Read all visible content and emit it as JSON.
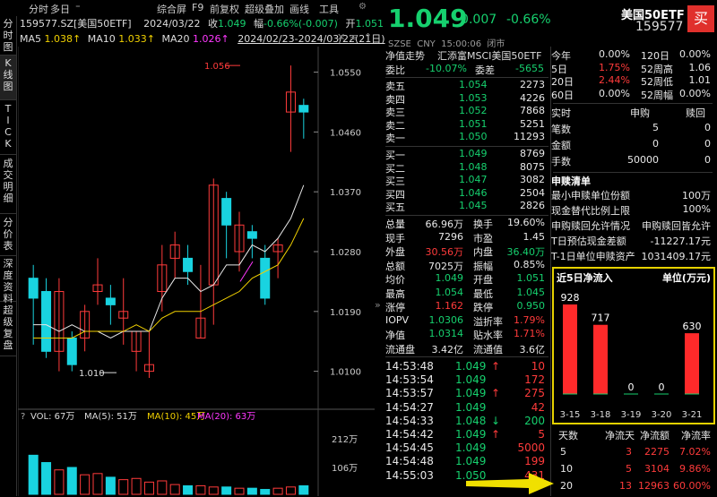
{
  "topbar": {
    "tab_intraday": "分时",
    "tab_multiday": "多日",
    "settings_glyph": "⁼",
    "comprehensive": "综合屏",
    "f9": "F9",
    "prev_adj": "前复权",
    "overlay": "超级叠加",
    "draw": "画线",
    "tools": "工具"
  },
  "info": {
    "code_name": "159577.SZ[美国50ETF]",
    "date": "2024/03/22",
    "close_label": "收",
    "close": "1.049",
    "amp_label": "幅",
    "amp": "-0.66%(-0.007)",
    "open_label": "开",
    "open": "1.051"
  },
  "ma": {
    "ma5": "MA5",
    "ma5_val": "1.038↑",
    "ma10": "MA10",
    "ma10_val": "1.033↑",
    "ma20": "MA20",
    "ma20_val": "1.026↑",
    "range": "2024/02/23-2024/03/22(21日)"
  },
  "sidetabs": [
    "分时图",
    "K线图",
    "TICK",
    "成交明细",
    "分价表",
    "深度资料",
    "超级复盘"
  ],
  "kline": {
    "high_label": "1.056",
    "low_label": "1.010",
    "price_ticks": [
      "1.0550",
      "1.0460",
      "1.0370",
      "1.0280",
      "1.0190",
      "1.0100"
    ],
    "candles": [
      [
        1.024,
        1.021,
        1.026,
        1.014
      ],
      [
        1.022,
        1.013,
        1.024,
        1.012
      ],
      [
        1.013,
        1.022,
        1.024,
        1.01
      ],
      [
        1.015,
        1.011,
        1.016,
        1.01
      ],
      [
        1.015,
        1.019,
        1.02,
        1.013
      ],
      [
        1.022,
        1.023,
        1.027,
        1.02
      ],
      [
        1.021,
        1.02,
        1.023,
        1.017
      ],
      [
        1.018,
        1.019,
        1.024,
        1.014
      ],
      [
        1.013,
        1.016,
        1.016,
        1.01
      ],
      [
        1.01,
        1.011,
        1.016,
        1.009
      ],
      [
        1.022,
        1.026,
        1.029,
        1.019
      ],
      [
        1.027,
        1.029,
        1.031,
        1.024
      ],
      [
        1.027,
        1.025,
        1.029,
        1.023
      ],
      [
        1.015,
        1.018,
        1.026,
        1.015
      ],
      [
        1.023,
        1.038,
        1.039,
        1.017
      ],
      [
        1.036,
        1.032,
        1.037,
        1.027
      ],
      [
        1.028,
        1.032,
        1.034,
        1.025
      ],
      [
        1.031,
        1.03,
        1.032,
        1.027
      ],
      [
        1.027,
        1.021,
        1.029,
        1.02
      ],
      [
        1.028,
        1.029,
        1.03,
        1.024
      ],
      [
        1.049,
        1.052,
        1.056,
        1.043
      ],
      [
        1.05,
        1.049,
        1.051,
        1.045
      ]
    ],
    "ma5": [
      1.017,
      1.017,
      1.016,
      1.017,
      1.016,
      1.016,
      1.015,
      1.016,
      1.016,
      1.016,
      1.021,
      1.024,
      1.024,
      1.022,
      1.023,
      1.026,
      1.026,
      1.029,
      1.028,
      1.03,
      1.033,
      1.038
    ],
    "ma10": [
      1.015,
      1.015,
      1.015,
      1.015,
      1.016,
      1.016,
      1.016,
      1.016,
      1.017,
      1.016,
      1.018,
      1.019,
      1.019,
      1.019,
      1.02,
      1.021,
      1.022,
      1.024,
      1.025,
      1.026,
      1.029,
      1.033
    ],
    "ma20_start": 20,
    "ma20": [
      1.026
    ]
  },
  "volume": {
    "label": "VOL: 67万",
    "ma5": "MA(5): 51万",
    "ma10": "MA(10): 45万",
    "ma20": "MA(20): 63万",
    "ticks": [
      "212万",
      "106万"
    ],
    "bars": [
      0.32,
      0.26,
      0.2,
      0.22,
      0.16,
      0.17,
      0.14,
      0.12,
      0.13,
      0.1,
      0.11,
      0.08,
      0.07,
      0.07,
      0.06,
      0.06,
      0.05,
      0.05,
      0.04,
      0.05,
      0.06,
      0.07
    ]
  },
  "quote": {
    "price": "1.049",
    "chg": "-0.007",
    "pct": "-0.66%",
    "name": "美国50ETF",
    "code": "159577",
    "sell": "买",
    "meta": "SZSE  CNY  15:00:06  闭市",
    "trend_label": "净值走势",
    "fund_name": "汇添富MSCI美国50ETF",
    "weibi_label": "委比",
    "weibi": "-10.07%",
    "weicha_label": "委差",
    "weicha": "-5655"
  },
  "asks": [
    [
      "卖五",
      "1.054",
      "2273"
    ],
    [
      "卖四",
      "1.053",
      "4226"
    ],
    [
      "卖三",
      "1.052",
      "7868"
    ],
    [
      "卖二",
      "1.051",
      "5251"
    ],
    [
      "卖一",
      "1.050",
      "11293"
    ]
  ],
  "bids": [
    [
      "买一",
      "1.049",
      "8769"
    ],
    [
      "买二",
      "1.048",
      "8075"
    ],
    [
      "买三",
      "1.047",
      "3082"
    ],
    [
      "买四",
      "1.046",
      "2504"
    ],
    [
      "买五",
      "1.045",
      "2826"
    ]
  ],
  "stats": [
    [
      "总量",
      "66.96万",
      "换手",
      "19.60%"
    ],
    [
      "现手",
      "7296",
      "市盈",
      "1.45"
    ],
    [
      "外盘",
      "30.56万",
      "内盘",
      "36.40万"
    ],
    [
      "总额",
      "7025万",
      "振幅",
      "0.85%"
    ],
    [
      "均价",
      "1.049",
      "开盘",
      "1.051"
    ],
    [
      "最高",
      "1.054",
      "最低",
      "1.045"
    ],
    [
      "涨停",
      "1.162",
      "跌停",
      "0.950"
    ],
    [
      "IOPV",
      "1.0306",
      "溢折率",
      "1.79%"
    ],
    [
      "净值",
      "1.0314",
      "贴水率",
      "1.71%"
    ],
    [
      "流通盘",
      "3.42亿",
      "流通值",
      "3.6亿"
    ]
  ],
  "trades": [
    [
      "14:53:48",
      "1.049",
      "↑",
      "10"
    ],
    [
      "14:53:54",
      "1.049",
      "",
      "172"
    ],
    [
      "14:53:57",
      "1.049",
      "↑",
      "275"
    ],
    [
      "14:54:27",
      "1.049",
      "",
      "42"
    ],
    [
      "14:54:33",
      "1.048",
      "↓",
      "200"
    ],
    [
      "14:54:42",
      "1.049",
      "↑",
      "5"
    ],
    [
      "14:54:45",
      "1.049",
      "",
      "5000"
    ],
    [
      "14:54:48",
      "1.049",
      "",
      "199"
    ],
    [
      "14:55:03",
      "1.050",
      "",
      "431"
    ]
  ],
  "perf": [
    [
      "今年",
      "0.00%",
      "120日",
      "0.00%"
    ],
    [
      "5日",
      "1.75%",
      "52周高",
      "1.06"
    ],
    [
      "20日",
      "2.44%",
      "52周低",
      "1.01"
    ],
    [
      "60日",
      "0.00%",
      "52周幅",
      "0.00%"
    ]
  ],
  "realtime": {
    "title": "实时",
    "sub": "申购",
    "redeem": "赎回",
    "rows": [
      [
        "笔数",
        "5",
        "0"
      ],
      [
        "金额",
        "0",
        "0"
      ],
      [
        "手数",
        "50000",
        "0"
      ]
    ]
  },
  "creation": {
    "title": "申赎清单",
    "rows": [
      [
        "最小申赎单位份额",
        "100万"
      ],
      [
        "现金替代比例上限",
        "100%"
      ],
      [
        "申购赎回允许情况",
        "申购赎回皆允许"
      ],
      [
        "T日预估现金差额",
        "-11227.17元"
      ],
      [
        "T-1日单位申赎资产",
        "1031409.17元"
      ]
    ]
  },
  "netflow": {
    "title": "近5日净流入",
    "unit": "单位(万元)",
    "dates": [
      "3-15",
      "3-18",
      "3-19",
      "3-20",
      "3-21"
    ],
    "values": [
      928,
      717,
      0,
      0,
      630
    ]
  },
  "flowtable": {
    "headers": [
      "天数",
      "净流天",
      "净流额",
      "净流率"
    ],
    "rows": [
      [
        "5",
        "3",
        "2275",
        "7.02%"
      ],
      [
        "10",
        "5",
        "3104",
        "9.86%"
      ],
      [
        "20",
        "13",
        "12963",
        "60.00%"
      ]
    ]
  },
  "colors": {
    "up": "#ff3b3b",
    "down": "#19d3e0",
    "ma5": "#e8e8e8",
    "ma10": "#f0d000",
    "ma20": "#ff38ff",
    "box": "#e6d200"
  }
}
